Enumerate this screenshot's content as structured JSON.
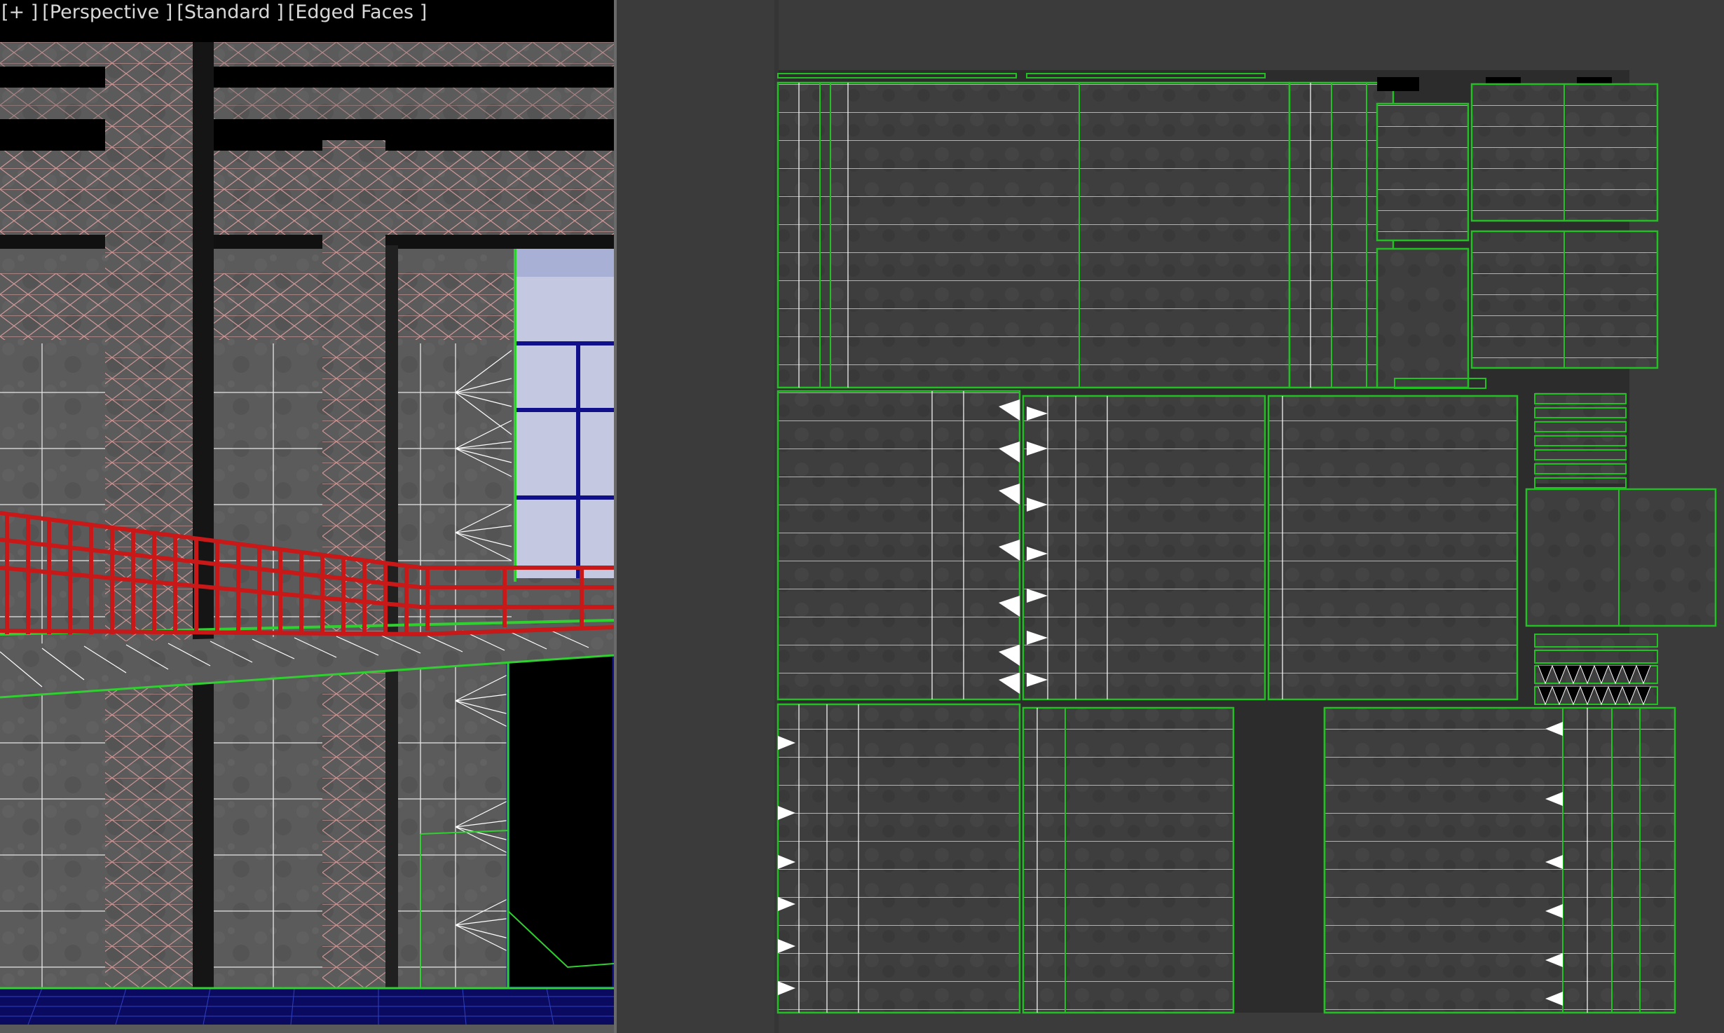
{
  "viewport": {
    "label_plus": "[+ ]",
    "label_view": "[Perspective ]",
    "label_shading": "[Standard ]",
    "label_edges": "[Edged Faces ]"
  },
  "colors": {
    "wire_pink": "#f0a0a0",
    "wire_white": "#ffffff",
    "wire_green": "#30d030",
    "railing_red": "#c81818",
    "window_blue": "#10108a",
    "uv_green": "#22c022",
    "concrete": "#5a5a5a"
  },
  "icons": {
    "viewport_menu": "plus-icon"
  }
}
